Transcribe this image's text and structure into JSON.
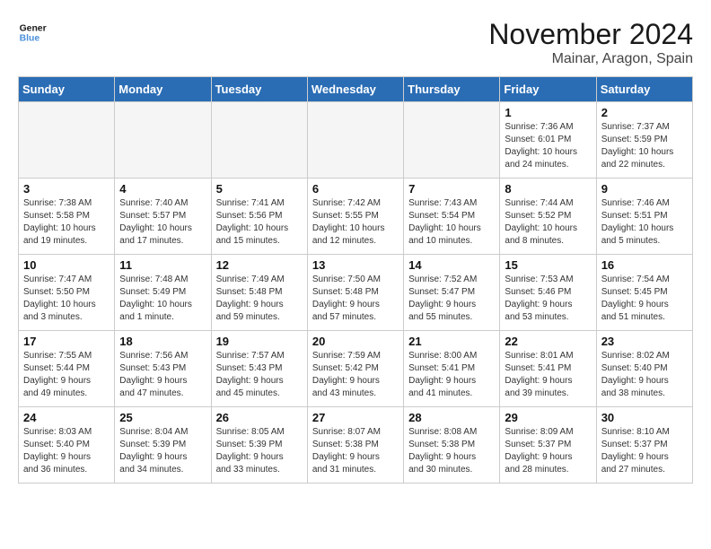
{
  "logo": {
    "line1": "General",
    "line2": "Blue"
  },
  "title": "November 2024",
  "subtitle": "Mainar, Aragon, Spain",
  "days_of_week": [
    "Sunday",
    "Monday",
    "Tuesday",
    "Wednesday",
    "Thursday",
    "Friday",
    "Saturday"
  ],
  "weeks": [
    [
      {
        "day": "",
        "info": ""
      },
      {
        "day": "",
        "info": ""
      },
      {
        "day": "",
        "info": ""
      },
      {
        "day": "",
        "info": ""
      },
      {
        "day": "",
        "info": ""
      },
      {
        "day": "1",
        "info": "Sunrise: 7:36 AM\nSunset: 6:01 PM\nDaylight: 10 hours\nand 24 minutes."
      },
      {
        "day": "2",
        "info": "Sunrise: 7:37 AM\nSunset: 5:59 PM\nDaylight: 10 hours\nand 22 minutes."
      }
    ],
    [
      {
        "day": "3",
        "info": "Sunrise: 7:38 AM\nSunset: 5:58 PM\nDaylight: 10 hours\nand 19 minutes."
      },
      {
        "day": "4",
        "info": "Sunrise: 7:40 AM\nSunset: 5:57 PM\nDaylight: 10 hours\nand 17 minutes."
      },
      {
        "day": "5",
        "info": "Sunrise: 7:41 AM\nSunset: 5:56 PM\nDaylight: 10 hours\nand 15 minutes."
      },
      {
        "day": "6",
        "info": "Sunrise: 7:42 AM\nSunset: 5:55 PM\nDaylight: 10 hours\nand 12 minutes."
      },
      {
        "day": "7",
        "info": "Sunrise: 7:43 AM\nSunset: 5:54 PM\nDaylight: 10 hours\nand 10 minutes."
      },
      {
        "day": "8",
        "info": "Sunrise: 7:44 AM\nSunset: 5:52 PM\nDaylight: 10 hours\nand 8 minutes."
      },
      {
        "day": "9",
        "info": "Sunrise: 7:46 AM\nSunset: 5:51 PM\nDaylight: 10 hours\nand 5 minutes."
      }
    ],
    [
      {
        "day": "10",
        "info": "Sunrise: 7:47 AM\nSunset: 5:50 PM\nDaylight: 10 hours\nand 3 minutes."
      },
      {
        "day": "11",
        "info": "Sunrise: 7:48 AM\nSunset: 5:49 PM\nDaylight: 10 hours\nand 1 minute."
      },
      {
        "day": "12",
        "info": "Sunrise: 7:49 AM\nSunset: 5:48 PM\nDaylight: 9 hours\nand 59 minutes."
      },
      {
        "day": "13",
        "info": "Sunrise: 7:50 AM\nSunset: 5:48 PM\nDaylight: 9 hours\nand 57 minutes."
      },
      {
        "day": "14",
        "info": "Sunrise: 7:52 AM\nSunset: 5:47 PM\nDaylight: 9 hours\nand 55 minutes."
      },
      {
        "day": "15",
        "info": "Sunrise: 7:53 AM\nSunset: 5:46 PM\nDaylight: 9 hours\nand 53 minutes."
      },
      {
        "day": "16",
        "info": "Sunrise: 7:54 AM\nSunset: 5:45 PM\nDaylight: 9 hours\nand 51 minutes."
      }
    ],
    [
      {
        "day": "17",
        "info": "Sunrise: 7:55 AM\nSunset: 5:44 PM\nDaylight: 9 hours\nand 49 minutes."
      },
      {
        "day": "18",
        "info": "Sunrise: 7:56 AM\nSunset: 5:43 PM\nDaylight: 9 hours\nand 47 minutes."
      },
      {
        "day": "19",
        "info": "Sunrise: 7:57 AM\nSunset: 5:43 PM\nDaylight: 9 hours\nand 45 minutes."
      },
      {
        "day": "20",
        "info": "Sunrise: 7:59 AM\nSunset: 5:42 PM\nDaylight: 9 hours\nand 43 minutes."
      },
      {
        "day": "21",
        "info": "Sunrise: 8:00 AM\nSunset: 5:41 PM\nDaylight: 9 hours\nand 41 minutes."
      },
      {
        "day": "22",
        "info": "Sunrise: 8:01 AM\nSunset: 5:41 PM\nDaylight: 9 hours\nand 39 minutes."
      },
      {
        "day": "23",
        "info": "Sunrise: 8:02 AM\nSunset: 5:40 PM\nDaylight: 9 hours\nand 38 minutes."
      }
    ],
    [
      {
        "day": "24",
        "info": "Sunrise: 8:03 AM\nSunset: 5:40 PM\nDaylight: 9 hours\nand 36 minutes."
      },
      {
        "day": "25",
        "info": "Sunrise: 8:04 AM\nSunset: 5:39 PM\nDaylight: 9 hours\nand 34 minutes."
      },
      {
        "day": "26",
        "info": "Sunrise: 8:05 AM\nSunset: 5:39 PM\nDaylight: 9 hours\nand 33 minutes."
      },
      {
        "day": "27",
        "info": "Sunrise: 8:07 AM\nSunset: 5:38 PM\nDaylight: 9 hours\nand 31 minutes."
      },
      {
        "day": "28",
        "info": "Sunrise: 8:08 AM\nSunset: 5:38 PM\nDaylight: 9 hours\nand 30 minutes."
      },
      {
        "day": "29",
        "info": "Sunrise: 8:09 AM\nSunset: 5:37 PM\nDaylight: 9 hours\nand 28 minutes."
      },
      {
        "day": "30",
        "info": "Sunrise: 8:10 AM\nSunset: 5:37 PM\nDaylight: 9 hours\nand 27 minutes."
      }
    ]
  ]
}
